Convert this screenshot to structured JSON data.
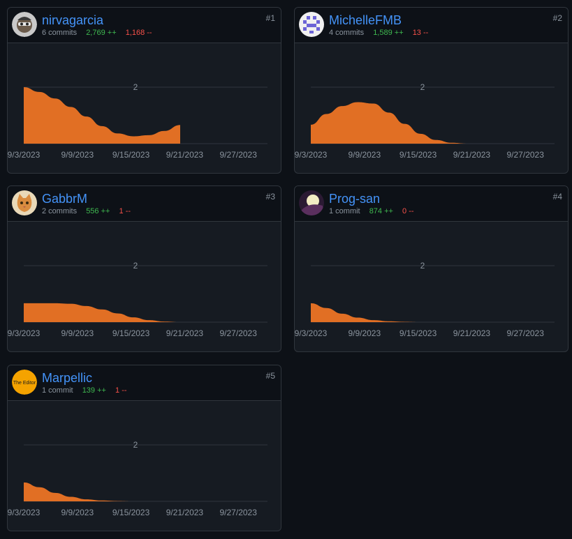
{
  "colors": {
    "area": "#e16f24",
    "add": "#3fb950",
    "del": "#f85149",
    "link": "#4493f8"
  },
  "axis": {
    "x_ticks": [
      "9/3/2023",
      "9/9/2023",
      "9/15/2023",
      "9/21/2023",
      "9/27/2023"
    ],
    "y_tick": "2"
  },
  "contributors": [
    {
      "rank": "#1",
      "name": "nirvagarcia",
      "commits": "6 commits",
      "additions": "2,769 ++",
      "deletions": "1,168 --",
      "avatar_icon": "avatar-cartoon-icon",
      "series": [
        [
          0,
          2.0
        ],
        [
          1.75,
          1.83
        ],
        [
          3.5,
          1.6
        ],
        [
          5.25,
          1.3
        ],
        [
          7,
          0.96
        ],
        [
          8.75,
          0.62
        ],
        [
          10.5,
          0.36
        ],
        [
          12.25,
          0.26
        ],
        [
          14,
          0.3
        ],
        [
          15.75,
          0.45
        ],
        [
          17.5,
          0.66
        ]
      ]
    },
    {
      "rank": "#2",
      "name": "MichelleFMB",
      "commits": "4 commits",
      "additions": "1,589 ++",
      "deletions": "13 --",
      "avatar_icon": "avatar-identicon-icon",
      "series": [
        [
          0,
          0.67
        ],
        [
          1.75,
          1.05
        ],
        [
          3.5,
          1.33
        ],
        [
          5.25,
          1.47
        ],
        [
          7,
          1.42
        ],
        [
          8.75,
          1.1
        ],
        [
          10.5,
          0.7
        ],
        [
          12.25,
          0.35
        ],
        [
          14,
          0.13
        ],
        [
          15.75,
          0.03
        ],
        [
          17.5,
          0.0
        ],
        [
          19.25,
          0.0
        ],
        [
          21,
          0.0
        ],
        [
          22.75,
          0.0
        ]
      ]
    },
    {
      "rank": "#3",
      "name": "GabbrM",
      "commits": "2 commits",
      "additions": "556 ++",
      "deletions": "1 --",
      "avatar_icon": "avatar-cat-icon",
      "series": [
        [
          0,
          0.67
        ],
        [
          1.75,
          0.67
        ],
        [
          3.5,
          0.67
        ],
        [
          5.25,
          0.65
        ],
        [
          7,
          0.57
        ],
        [
          8.75,
          0.45
        ],
        [
          10.5,
          0.31
        ],
        [
          12.25,
          0.17
        ],
        [
          14,
          0.07
        ],
        [
          15.75,
          0.02
        ],
        [
          17.5,
          0.0
        ],
        [
          19.25,
          0.0
        ],
        [
          21,
          0.0
        ],
        [
          22.75,
          0.0
        ]
      ]
    },
    {
      "rank": "#4",
      "name": "Prog-san",
      "commits": "1 commit",
      "additions": "874 ++",
      "deletions": "0 --",
      "avatar_icon": "avatar-moon-icon",
      "series": [
        [
          0,
          0.67
        ],
        [
          1.75,
          0.5
        ],
        [
          3.5,
          0.3
        ],
        [
          5.25,
          0.16
        ],
        [
          7,
          0.07
        ],
        [
          8.75,
          0.03
        ],
        [
          10.5,
          0.01
        ],
        [
          12.25,
          0.0
        ],
        [
          14,
          0.0
        ],
        [
          15.75,
          0.0
        ],
        [
          17.5,
          0.0
        ],
        [
          19.25,
          0.0
        ],
        [
          21,
          0.0
        ],
        [
          22.75,
          0.0
        ]
      ]
    },
    {
      "rank": "#5",
      "name": "Marpellic",
      "commits": "1 commit",
      "additions": "139 ++",
      "deletions": "1 --",
      "avatar_icon": "avatar-logo-icon",
      "avatar_text": "The Editor",
      "series": [
        [
          0,
          0.67
        ],
        [
          1.75,
          0.5
        ],
        [
          3.5,
          0.3
        ],
        [
          5.25,
          0.16
        ],
        [
          7,
          0.07
        ],
        [
          8.75,
          0.03
        ],
        [
          10.5,
          0.01
        ],
        [
          12.25,
          0.0
        ],
        [
          14,
          0.0
        ],
        [
          15.75,
          0.0
        ],
        [
          17.5,
          0.0
        ],
        [
          19.25,
          0.0
        ],
        [
          21,
          0.0
        ],
        [
          22.75,
          0.0
        ]
      ]
    }
  ],
  "chart_data": [
    {
      "type": "area",
      "series": [
        {
          "name": "nirvagarcia",
          "x": [
            "9/3/2023",
            "9/5/2023",
            "9/7/2023",
            "9/9/2023",
            "9/10/2023",
            "9/12/2023",
            "9/14/2023",
            "9/15/2023",
            "9/17/2023",
            "9/19/2023",
            "9/21/2023"
          ],
          "values": [
            2.0,
            1.83,
            1.6,
            1.3,
            0.96,
            0.62,
            0.36,
            0.26,
            0.3,
            0.45,
            0.66
          ]
        }
      ],
      "ylim": [
        0,
        2.7
      ],
      "y_ticks": [
        "2"
      ],
      "x_ticks": [
        "9/3/2023",
        "9/9/2023",
        "9/15/2023",
        "9/21/2023",
        "9/27/2023"
      ],
      "grid": true
    },
    {
      "type": "area",
      "series": [
        {
          "name": "MichelleFMB",
          "x": [
            "9/3/2023",
            "9/5/2023",
            "9/7/2023",
            "9/9/2023",
            "9/10/2023",
            "9/12/2023",
            "9/14/2023",
            "9/15/2023",
            "9/17/2023",
            "9/19/2023",
            "9/21/2023",
            "9/22/2023",
            "9/24/2023",
            "9/26/2023"
          ],
          "values": [
            0.67,
            1.05,
            1.33,
            1.47,
            1.42,
            1.1,
            0.7,
            0.35,
            0.13,
            0.03,
            0,
            0,
            0,
            0
          ]
        }
      ],
      "ylim": [
        0,
        2.7
      ],
      "y_ticks": [
        "2"
      ],
      "x_ticks": [
        "9/3/2023",
        "9/9/2023",
        "9/15/2023",
        "9/21/2023",
        "9/27/2023"
      ],
      "grid": true
    },
    {
      "type": "area",
      "series": [
        {
          "name": "GabbrM",
          "x": [
            "9/3/2023",
            "9/5/2023",
            "9/7/2023",
            "9/9/2023",
            "9/10/2023",
            "9/12/2023",
            "9/14/2023",
            "9/15/2023",
            "9/17/2023",
            "9/19/2023",
            "9/21/2023",
            "9/22/2023",
            "9/24/2023",
            "9/26/2023"
          ],
          "values": [
            0.67,
            0.67,
            0.67,
            0.65,
            0.57,
            0.45,
            0.31,
            0.17,
            0.07,
            0.02,
            0,
            0,
            0,
            0
          ]
        }
      ],
      "ylim": [
        0,
        2.7
      ],
      "y_ticks": [
        "2"
      ],
      "x_ticks": [
        "9/3/2023",
        "9/9/2023",
        "9/15/2023",
        "9/21/2023",
        "9/27/2023"
      ],
      "grid": true
    },
    {
      "type": "area",
      "series": [
        {
          "name": "Prog-san",
          "x": [
            "9/3/2023",
            "9/5/2023",
            "9/7/2023",
            "9/9/2023",
            "9/10/2023",
            "9/12/2023",
            "9/14/2023",
            "9/15/2023",
            "9/17/2023",
            "9/19/2023",
            "9/21/2023",
            "9/22/2023",
            "9/24/2023",
            "9/26/2023"
          ],
          "values": [
            0.67,
            0.5,
            0.3,
            0.16,
            0.07,
            0.03,
            0.01,
            0,
            0,
            0,
            0,
            0,
            0,
            0
          ]
        }
      ],
      "ylim": [
        0,
        2.7
      ],
      "y_ticks": [
        "2"
      ],
      "x_ticks": [
        "9/3/2023",
        "9/9/2023",
        "9/15/2023",
        "9/21/2023",
        "9/27/2023"
      ],
      "grid": true
    },
    {
      "type": "area",
      "series": [
        {
          "name": "Marpellic",
          "x": [
            "9/3/2023",
            "9/5/2023",
            "9/7/2023",
            "9/9/2023",
            "9/10/2023",
            "9/12/2023",
            "9/14/2023",
            "9/15/2023",
            "9/17/2023",
            "9/19/2023",
            "9/21/2023",
            "9/22/2023",
            "9/24/2023",
            "9/26/2023"
          ],
          "values": [
            0.67,
            0.5,
            0.3,
            0.16,
            0.07,
            0.03,
            0.01,
            0,
            0,
            0,
            0,
            0,
            0,
            0
          ]
        }
      ],
      "ylim": [
        0,
        2.7
      ],
      "y_ticks": [
        "2"
      ],
      "x_ticks": [
        "9/3/2023",
        "9/9/2023",
        "9/15/2023",
        "9/21/2023",
        "9/27/2023"
      ],
      "grid": true
    }
  ]
}
